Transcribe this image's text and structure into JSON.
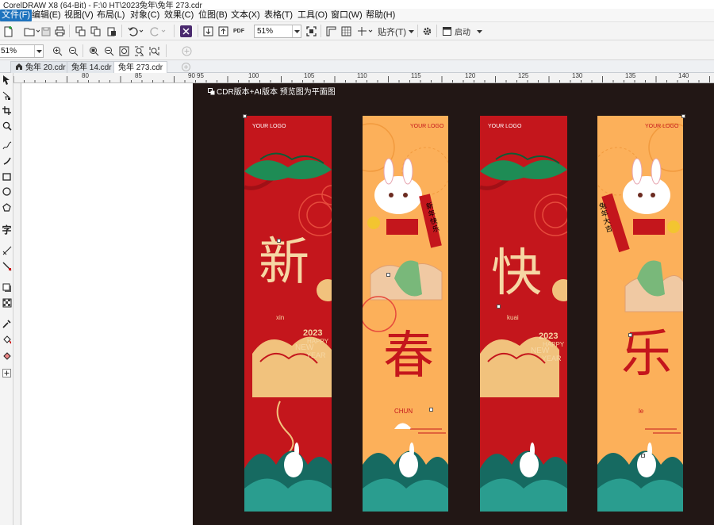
{
  "window": {
    "title": "CorelDRAW X8 (64-Bit) - F:\\0 HT\\2023兔年\\兔年 273.cdr"
  },
  "menu": [
    {
      "label": "文件(F)",
      "active": true
    },
    {
      "label": "编辑(E)"
    },
    {
      "label": "视图(V)"
    },
    {
      "label": "布局(L)"
    },
    {
      "label": "对象(C)"
    },
    {
      "label": "效果(C)"
    },
    {
      "label": "位图(B)"
    },
    {
      "label": "文本(X)"
    },
    {
      "label": "表格(T)"
    },
    {
      "label": "工具(O)"
    },
    {
      "label": "窗口(W)"
    },
    {
      "label": "帮助(H)"
    }
  ],
  "toolbar": {
    "zoom": "51%",
    "snap_label": "贴齐(T)",
    "launch_label": "启动",
    "pdf_label": "PDF"
  },
  "toolbar2": {
    "zoom": "51%"
  },
  "tabs": [
    {
      "label": "兔年 20.cdr"
    },
    {
      "label": "兔年 14.cdr"
    },
    {
      "label": "兔年 273.cdr",
      "active": true
    }
  ],
  "ruler": {
    "marks": [
      "80",
      "85",
      "90",
      "95",
      "100",
      "105",
      "110",
      "115",
      "120",
      "125",
      "130",
      "135",
      "140"
    ]
  },
  "artboard": {
    "note": "CDR版本+AI版本 预览图为平面图"
  },
  "banners": [
    {
      "bg": "#c4161c",
      "char": "新",
      "char_color": "#f6d7a4",
      "pinyin": "xin",
      "logo": "YOUR LOGO",
      "year": "2023",
      "happy": "HAPPY",
      "new": "NEW",
      "year_word": "YEAR"
    },
    {
      "bg": "#fcb05a",
      "char": "春",
      "char_color": "#c4161c",
      "pinyin": "CHUN",
      "logo": "YOUR LOGO",
      "scroll": "新年快乐"
    },
    {
      "bg": "#c4161c",
      "char": "快",
      "char_color": "#f6d7a4",
      "pinyin": "kuai",
      "logo": "YOUR LOGO",
      "year": "2023",
      "happy": "HAPPY",
      "new": "NEW",
      "year_word": "YEAR"
    },
    {
      "bg": "#fcb05a",
      "char": "乐",
      "char_color": "#c4161c",
      "pinyin": "le",
      "logo": "YOUR LOGO",
      "scroll": "兔年大吉"
    }
  ]
}
